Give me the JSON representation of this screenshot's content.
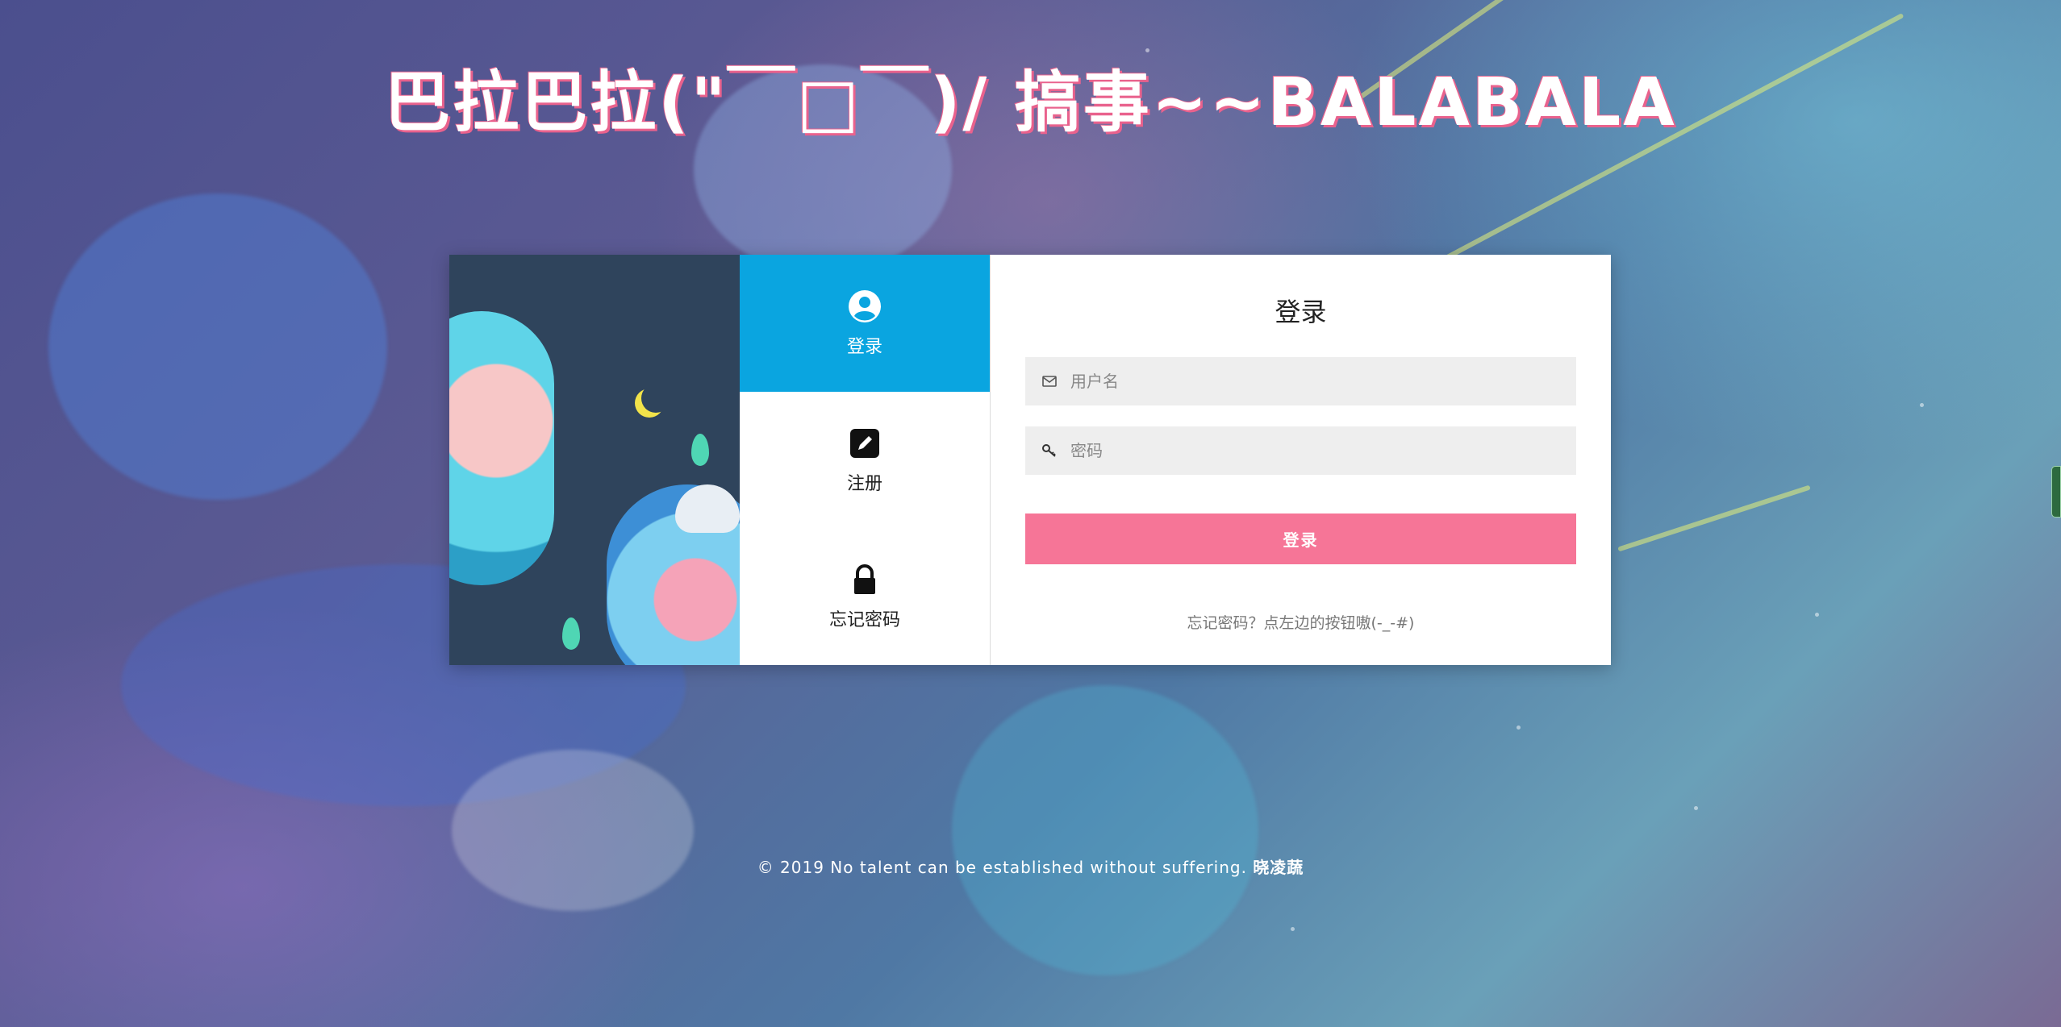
{
  "site_title": "巴拉巴拉(\"￣□￣)/ 搞事~~BALABALA",
  "nav": {
    "items": [
      {
        "label": "登录",
        "icon": "user-circle-icon",
        "active": true
      },
      {
        "label": "注册",
        "icon": "edit-icon",
        "active": false
      },
      {
        "label": "忘记密码",
        "icon": "lock-icon",
        "active": false
      }
    ]
  },
  "login_form": {
    "title": "登录",
    "username": {
      "placeholder": "用户名",
      "value": "",
      "icon": "envelope-icon"
    },
    "password": {
      "placeholder": "密码",
      "value": "",
      "icon": "key-icon"
    },
    "submit_label": "登录",
    "hint": "忘记密码？点左边的按钮嗷(-_-#)"
  },
  "footer": {
    "text": "© 2019 No talent can be established without suffering. ",
    "author": "晓凌蔬"
  },
  "colors": {
    "nav_active": "#0aa5e0",
    "submit": "#f67597",
    "title_shadow": "#e9628d"
  }
}
